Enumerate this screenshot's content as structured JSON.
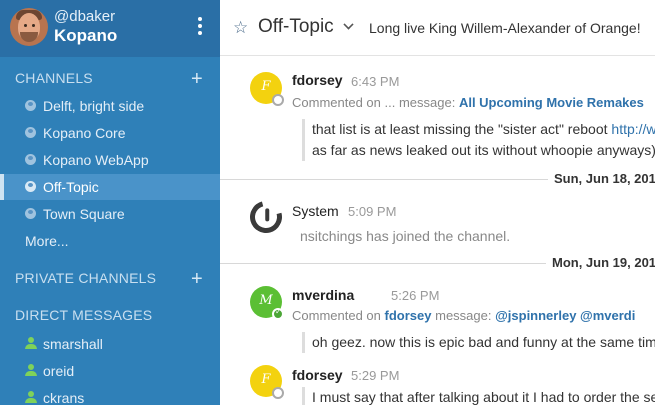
{
  "user": {
    "handle": "@dbaker",
    "team": "Kopano"
  },
  "sidebar": {
    "channels_header": "CHANNELS",
    "channels": [
      {
        "label": "Delft, bright side"
      },
      {
        "label": "Kopano Core"
      },
      {
        "label": "Kopano WebApp"
      },
      {
        "label": "Off-Topic",
        "active": true
      },
      {
        "label": "Town Square"
      }
    ],
    "more_label": "More...",
    "private_header": "PRIVATE CHANNELS",
    "direct_header": "DIRECT MESSAGES",
    "direct": [
      {
        "label": "smarshall"
      },
      {
        "label": "oreid"
      },
      {
        "label": "ckrans"
      }
    ],
    "add_icon": "plus-icon"
  },
  "channel": {
    "name": "Off-Topic",
    "purpose": "Long live King Willem-Alexander of Orange!"
  },
  "posts": [
    {
      "initial": "F",
      "user": "fdorsey",
      "time": "6:43 PM",
      "comment_prefix": "Commented on ... message:",
      "comment_link": "All Upcoming Movie Remakes",
      "quote_line1": "that list is at least missing the \"sister act\" reboot",
      "quote_url": "http://w",
      "quote_line2": "as far as news leaked out its without whoopie anyways)"
    },
    {
      "user": "System",
      "time": "5:09 PM",
      "text": "nsitchings has joined the channel."
    },
    {
      "initial": "M",
      "user": "mverdina",
      "time": "5:26 PM",
      "comment_prefix": "Commented on",
      "comment_link": "fdorsey",
      "comment_mid": "message:",
      "comment_mentions": "@jspinnerley @mverdi",
      "quote_line1": "oh geez. now this is epic bad and funny at the same time"
    },
    {
      "initial": "F",
      "user": "fdorsey",
      "time": "5:29 PM",
      "quote_line1": "I must say that after talking about it I had to order the se"
    }
  ],
  "date_separators": [
    "Sun, Jun 18, 201",
    "Mon, Jun 19, 201"
  ],
  "colors": {
    "sidebar": "#2f80b8",
    "accent_link": "#2f72ab"
  }
}
